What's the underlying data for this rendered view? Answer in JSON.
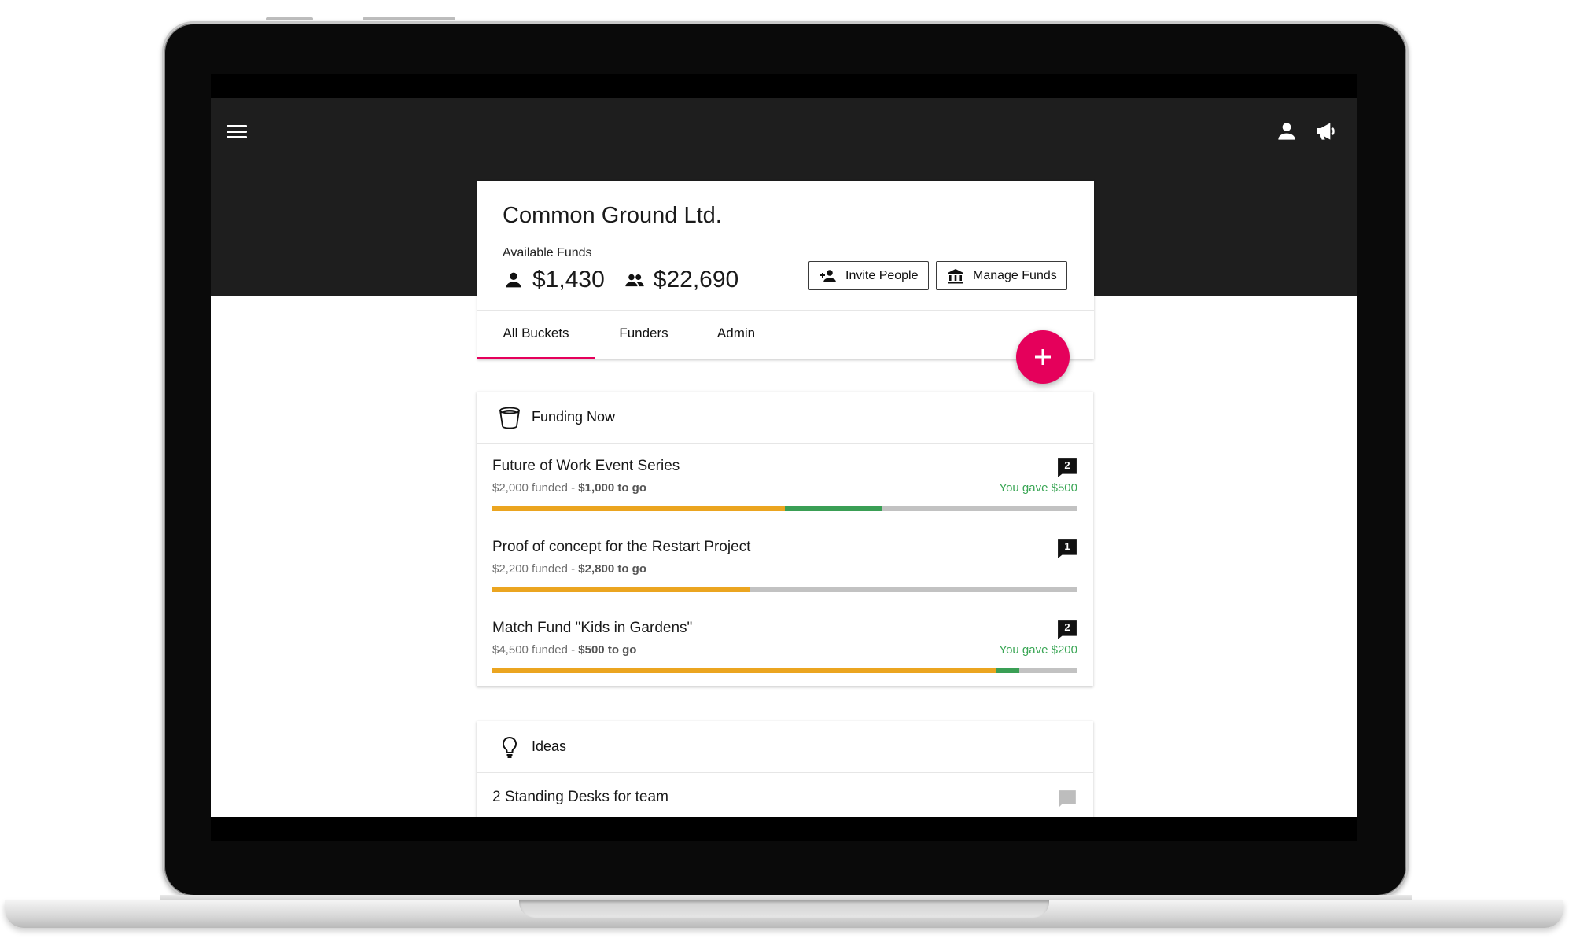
{
  "header": {
    "menu_icon": "menu-icon",
    "profile_icon": "person-icon",
    "announcements_icon": "megaphone-icon"
  },
  "org": {
    "name": "Common Ground Ltd.",
    "funds_label": "Available Funds",
    "personal_funds": "$1,430",
    "group_funds": "$22,690",
    "invite_label": "Invite People",
    "manage_label": "Manage Funds"
  },
  "tabs": [
    {
      "label": "All Buckets",
      "active": true
    },
    {
      "label": "Funders",
      "active": false
    },
    {
      "label": "Admin",
      "active": false
    }
  ],
  "fab": {
    "icon": "plus-icon"
  },
  "funding_now": {
    "title": "Funding Now",
    "icon": "bucket-icon",
    "buckets": [
      {
        "title": "Future of Work Event Series",
        "funded": "$2,000 funded",
        "separator": " - ",
        "to_go": "$1,000 to go",
        "gave": "You gave $500",
        "comments": "2",
        "progress_funded": 0.5,
        "progress_gave": 0.1667
      },
      {
        "title": "Proof of concept for the Restart Project",
        "funded": "$2,200 funded",
        "separator": " - ",
        "to_go": "$2,800 to go",
        "gave": "",
        "comments": "1",
        "progress_funded": 0.44,
        "progress_gave": 0
      },
      {
        "title": "Match Fund \"Kids in Gardens\"",
        "funded": "$4,500 funded",
        "separator": " - ",
        "to_go": "$500 to go",
        "gave": "You gave $200",
        "comments": "2",
        "progress_funded": 0.86,
        "progress_gave": 0.04
      }
    ]
  },
  "ideas": {
    "title": "Ideas",
    "icon": "lightbulb-icon",
    "items": [
      {
        "title": "2 Standing Desks for team",
        "comments": ""
      }
    ]
  },
  "colors": {
    "accent": "#e5005b",
    "funded": "#eba520",
    "gave": "#3a9f55",
    "track": "#c2c2c2",
    "header_bg": "#1e1e1e"
  }
}
